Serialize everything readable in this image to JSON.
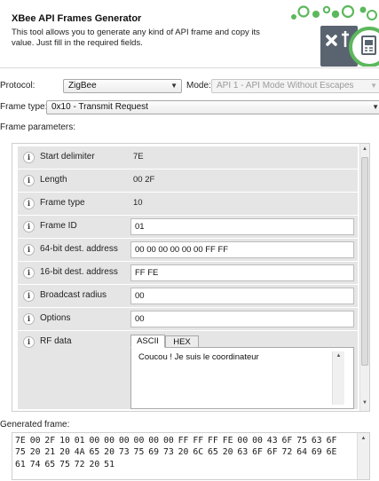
{
  "header": {
    "title": "XBee API Frames Generator",
    "description": "This tool allows you to generate any kind of API frame and copy its value. Just fill in the required fields."
  },
  "protocol": {
    "label": "Protocol:",
    "value": "ZigBee"
  },
  "mode": {
    "label": "Mode:",
    "value": "API 1 - API Mode Without Escapes"
  },
  "frame_type": {
    "label": "Frame type:",
    "value": "0x10 - Transmit Request"
  },
  "frame_params_label": "Frame parameters:",
  "params": [
    {
      "label": "Start delimiter",
      "value": "7E"
    },
    {
      "label": "Length",
      "value": "00 2F"
    },
    {
      "label": "Frame type",
      "value": "10"
    },
    {
      "label": "Frame ID",
      "value": "01"
    },
    {
      "label": "64-bit dest. address",
      "value": "00 00 00 00 00 00 FF FF"
    },
    {
      "label": "16-bit dest. address",
      "value": "FF FE"
    },
    {
      "label": "Broadcast radius",
      "value": "00"
    },
    {
      "label": "Options",
      "value": "00"
    }
  ],
  "rf_data": {
    "label": "RF data",
    "tabs": [
      "ASCII",
      "HEX"
    ],
    "active_tab": "ASCII",
    "text": "Coucou ! Je suis le coordinateur"
  },
  "info_glyph": "i",
  "generated": {
    "label": "Generated frame:",
    "text": "7E 00 2F 10 01 00 00 00 00 00 00 FF FF FF FE 00 00 43 6F 75 63 6F 75 20 21 20 4A 65 20 73 75 69 73 20 6C 65 20 63 6F 6F 72 64 69 6E 61 74 65 75 72 20 51"
  },
  "colors": {
    "row_bg": "#e5e5e5",
    "logo_green": "#5cb85c",
    "logo_gray": "#5a6470"
  }
}
